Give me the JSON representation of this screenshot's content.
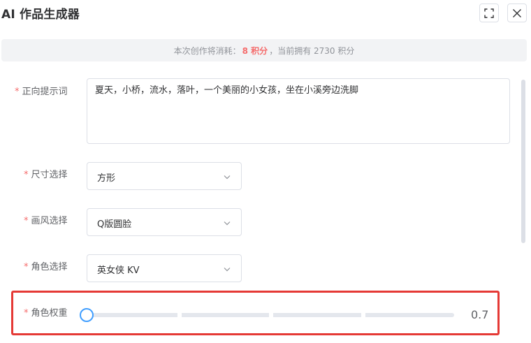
{
  "dialog": {
    "title": "AI 作品生成器",
    "icons": {
      "fullscreen": "fullscreen-icon",
      "close": "close-icon"
    }
  },
  "notice": {
    "prefix": "本次创作将消耗：",
    "cost": "8 积分",
    "suffix": "，当前拥有 2730 积分",
    "cost_color": "#f56c6c"
  },
  "form": {
    "required_mark": "*",
    "prompt": {
      "label": "正向提示词",
      "value": "夏天，小桥，流水，落叶，一个美丽的小女孩，坐在小溪旁边洗脚"
    },
    "size": {
      "label": "尺寸选择",
      "value": "方形"
    },
    "style": {
      "label": "画风选择",
      "value": "Q版圆脸"
    },
    "character": {
      "label": "角色选择",
      "value": "英女侠 KV"
    },
    "weight": {
      "label": "角色权重",
      "value": "0.7",
      "level": 0.0
    }
  },
  "colors": {
    "accent": "#409eff",
    "required": "#f56c6c",
    "highlight_border": "#e53935"
  }
}
